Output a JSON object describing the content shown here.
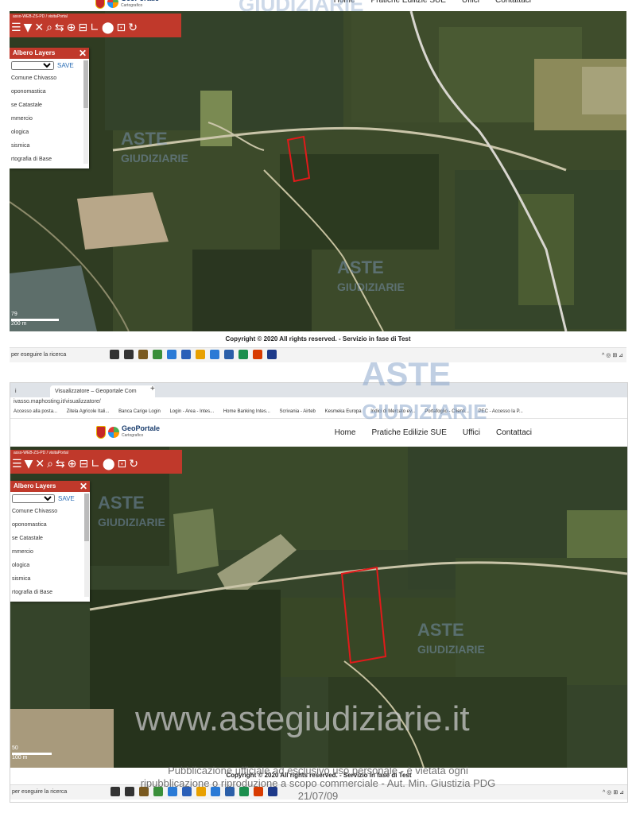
{
  "site": {
    "logo_title": "GeoPortale",
    "logo_subtitle": "Cartografico",
    "nav": [
      "Home",
      "Pratiche Edilizie SUE",
      "Uffici",
      "Contattaci"
    ]
  },
  "toolbar": {
    "label": "asso-WEB-ZS-PD / visitaPortal",
    "icons": [
      "☰",
      "▼",
      "✕",
      "⌕",
      "⇆",
      "⊕",
      "⊟",
      "∟",
      "⬤",
      "⊡",
      "↻"
    ]
  },
  "layers_panel": {
    "title": "Albero Layers",
    "save": "SAVE",
    "items": [
      "Comune Chivasso",
      "oponomastica",
      "se Catastale",
      "mmercio",
      "ologica",
      "sismica",
      "rtografia di Base"
    ]
  },
  "copyright": "Copyright © 2020 All rights reserved. - Servizio in fase di Test",
  "taskbar": {
    "search": "per eseguire la ricerca",
    "icon_colors": [
      "#333",
      "#333",
      "#7a5a20",
      "#3a8f3a",
      "#2a7ad6",
      "#2a5fb8",
      "#e8a000",
      "#2a7ad6",
      "#2b5fa8",
      "#1b8f4e",
      "#d83b01",
      "#1e3a8a"
    ],
    "tray": "^ ◎ ⊞ ⊿"
  },
  "browser": {
    "tab_inactive": "i",
    "tab_active": "Visualizzatore – Geoportale Com",
    "url": "ivasso.maphosting.it/visualizzatore/",
    "bookmarks": [
      "Accesso alla posta...",
      "Zitela Agricole Itali...",
      "Banca Carige Login",
      "Login - Area - Intes...",
      "Home Banking Intes...",
      "Scrivania - Airteb",
      "Kesmeka Europa",
      "Indici di Mercato ev...",
      "Portafoglio - Clienti...",
      "PEC - Accesso la P..."
    ]
  },
  "map": {
    "scale_1": "79",
    "scale_2": "50",
    "scale_unit_1": "200 m",
    "scale_unit_2": "100 m",
    "highlight_color": "#e11a1a"
  },
  "watermarks": {
    "brand_1": "ASTE",
    "brand_2": "GIUDIZIARIE",
    "site": "www.astegiudiziarie.it",
    "notice_line1": "Pubblicazione ufficiale ad esclusivo uso personale - è vietata ogni",
    "notice_line2": "ripubblicazione o riproduzione a scopo commerciale - Aut. Min. Giustizia PDG 21/07/09"
  }
}
